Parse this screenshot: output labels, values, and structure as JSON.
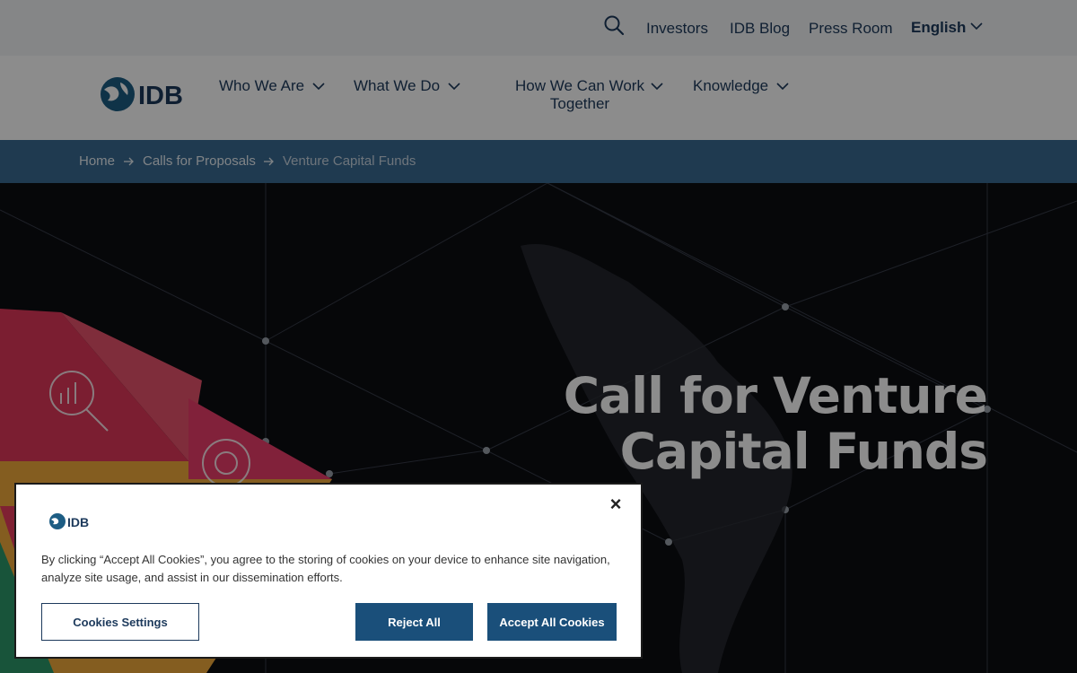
{
  "utility_bar": {
    "links": [
      "Investors",
      "IDB Blog",
      "Press Room"
    ],
    "language": "English",
    "search_icon": "search-icon"
  },
  "main_nav": {
    "logo_text": "IDB",
    "items": [
      {
        "label": "Who We Are"
      },
      {
        "label": "What We Do"
      },
      {
        "label": "How We Can Work Together"
      },
      {
        "label": "Knowledge"
      }
    ]
  },
  "breadcrumb": {
    "items": [
      "Home",
      "Calls for Proposals",
      "Venture Capital Funds"
    ]
  },
  "hero": {
    "title_line1": "Call for Venture",
    "title_line2": "Capital Funds"
  },
  "cookie_banner": {
    "logo_text": "IDB",
    "text": "By clicking “Accept All Cookies”, you agree to the storing of cookies on your device to enhance site navigation, analyze site usage, and assist in our dissemination efforts.",
    "close_icon": "close-icon",
    "settings_label": "Cookies Settings",
    "reject_label": "Reject All",
    "accept_label": "Accept All Cookies"
  },
  "colors": {
    "brand": "#1d3a5c",
    "breadcrumb_bg": "#3a6b93",
    "button_blue": "#1a4f7a"
  }
}
